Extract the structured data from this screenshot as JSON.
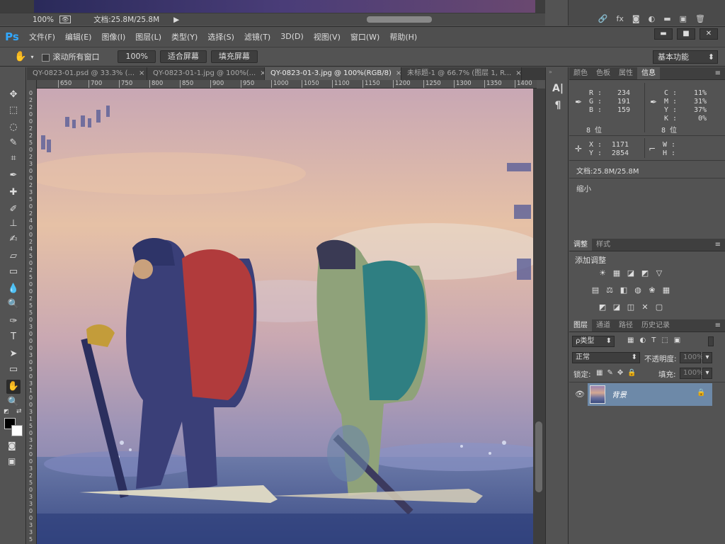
{
  "prev_doc": {
    "zoom": "100%",
    "doc_size": "文档:25.8M/25.8M",
    "panel_icons": [
      "link-icon",
      "fx-icon",
      "mask-icon",
      "adjust-icon",
      "folder-icon",
      "new-layer-icon",
      "trash-icon"
    ]
  },
  "app": {
    "logo": "Ps"
  },
  "menu": [
    "文件(F)",
    "编辑(E)",
    "图像(I)",
    "图层(L)",
    "类型(Y)",
    "选择(S)",
    "滤镜(T)",
    "3D(D)",
    "视图(V)",
    "窗口(W)",
    "帮助(H)"
  ],
  "window_buttons": [
    "▬",
    "■",
    "✕"
  ],
  "options": {
    "scroll_all": "滚动所有窗口",
    "zoom_100": "100%",
    "fit_screen": "适合屏幕",
    "fill_screen": "填充屏幕",
    "workspace": "基本功能"
  },
  "tabs": [
    {
      "label": "QY-0823-01.psd @ 33.3% (...",
      "active": false
    },
    {
      "label": "QY-0823-01-1.jpg @ 100%(...",
      "active": false
    },
    {
      "label": "QY-0823-01-3.jpg @ 100%(RGB/8)",
      "active": true
    },
    {
      "label": "未标题-1 @ 66.7% (图层 1, R...",
      "active": false
    }
  ],
  "ruler_h": [
    "650",
    "700",
    "750",
    "800",
    "850",
    "900",
    "950",
    "1000",
    "1050",
    "1100",
    "1150",
    "1200",
    "1250",
    "1300",
    "1350",
    "1400"
  ],
  "ruler_v": [
    "0",
    "2",
    "2",
    "0",
    "0",
    "2",
    "2",
    "5",
    "0",
    "2",
    "3",
    "0",
    "0",
    "2",
    "3",
    "5",
    "0",
    "2",
    "4",
    "0",
    "0",
    "2",
    "4",
    "5",
    "0",
    "2",
    "5",
    "0",
    "0",
    "2",
    "5",
    "5",
    "0",
    "3",
    "0",
    "0",
    "0",
    "3",
    "0",
    "5",
    "0",
    "3",
    "1",
    "0",
    "0",
    "3",
    "1",
    "5",
    "0",
    "3",
    "2",
    "0",
    "0",
    "3",
    "2",
    "5",
    "0",
    "3",
    "3",
    "0",
    "0",
    "3",
    "3",
    "5"
  ],
  "tools": [
    "move-icon",
    "marquee-icon",
    "lasso-icon",
    "quick-select-icon",
    "crop-icon",
    "eyedropper-icon",
    "spot-heal-icon",
    "brush-icon",
    "stamp-icon",
    "history-brush-icon",
    "eraser-icon",
    "gradient-icon",
    "blur-icon",
    "dodge-icon",
    "pen-icon",
    "type-icon",
    "path-select-icon",
    "rectangle-icon",
    "hand-icon",
    "zoom-icon"
  ],
  "tool_glyphs": [
    "✥",
    "⬚",
    "◌",
    "✎",
    "⌗",
    "✒",
    "✚",
    "✐",
    "⊥",
    "✍",
    "▱",
    "▭",
    "💧",
    "🔍",
    "✑",
    "T",
    "➤",
    "▭",
    "✋",
    "🔍"
  ],
  "info_panel": {
    "tabs": [
      "颜色",
      "色板",
      "属性",
      "信息"
    ],
    "active_tab": "信息",
    "rgb": {
      "R": "234",
      "G": "191",
      "B": "159"
    },
    "cmyk": {
      "C": "11%",
      "M": "31%",
      "Y": "37%",
      "K": "0%"
    },
    "bit_left": "8 位",
    "bit_right": "8 位",
    "x": "1171",
    "y": "2854",
    "w": "",
    "h": "",
    "doc": "文档:25.8M/25.8M",
    "hint": "缩小"
  },
  "adjust_panel": {
    "tabs": [
      "调整",
      "样式"
    ],
    "title": "添加调整",
    "row1": [
      "☀",
      "▦",
      "◪",
      "◩",
      "▽"
    ],
    "row2": [
      "▤",
      "⚖",
      "◧",
      "◍",
      "❀",
      "▦"
    ],
    "row3": [
      "◩",
      "◪",
      "◫",
      "✕",
      "▢"
    ]
  },
  "layers_panel": {
    "tabs": [
      "图层",
      "通道",
      "路径",
      "历史记录"
    ],
    "filter": "ρ类型",
    "blend_mode": "正常",
    "opacity_label": "不透明度:",
    "opacity_value": "100%",
    "lock_label": "锁定:",
    "fill_label": "填充:",
    "fill_value": "100%",
    "layer_name": "背景"
  },
  "colors": {
    "accent": "#31a8ff",
    "selected_layer": "#6d89a8"
  }
}
